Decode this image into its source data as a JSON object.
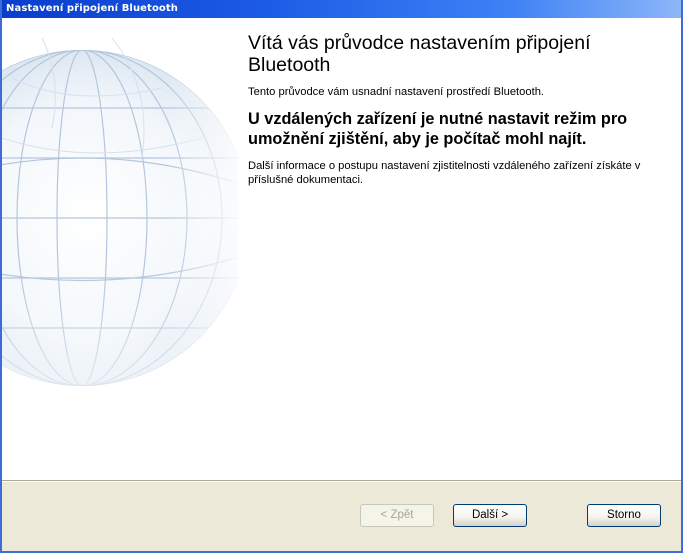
{
  "window": {
    "title": "Nastavení připojení Bluetooth"
  },
  "main": {
    "heading": "Vítá vás průvodce nastavením připojení Bluetooth",
    "intro": "Tento průvodce vám usnadní nastavení prostředí Bluetooth.",
    "notice": "U vzdálených zařízení je nutné nastavit režim pro umožnění zjištění, aby je počítač mohl najít.",
    "info": "Další informace o postupu nastavení zjistitelnosti vzdáleného zařízení získáte v příslušné dokumentaci."
  },
  "buttons": {
    "back": "< Zpět",
    "next": "Další >",
    "cancel": "Storno"
  },
  "colors": {
    "titlebar": "#0a3dcb",
    "footer": "#ece9d8",
    "globe": "#c9d8ea"
  },
  "icons": {
    "wizard_art": "globe-illustration"
  },
  "state": {
    "back_enabled": false
  }
}
